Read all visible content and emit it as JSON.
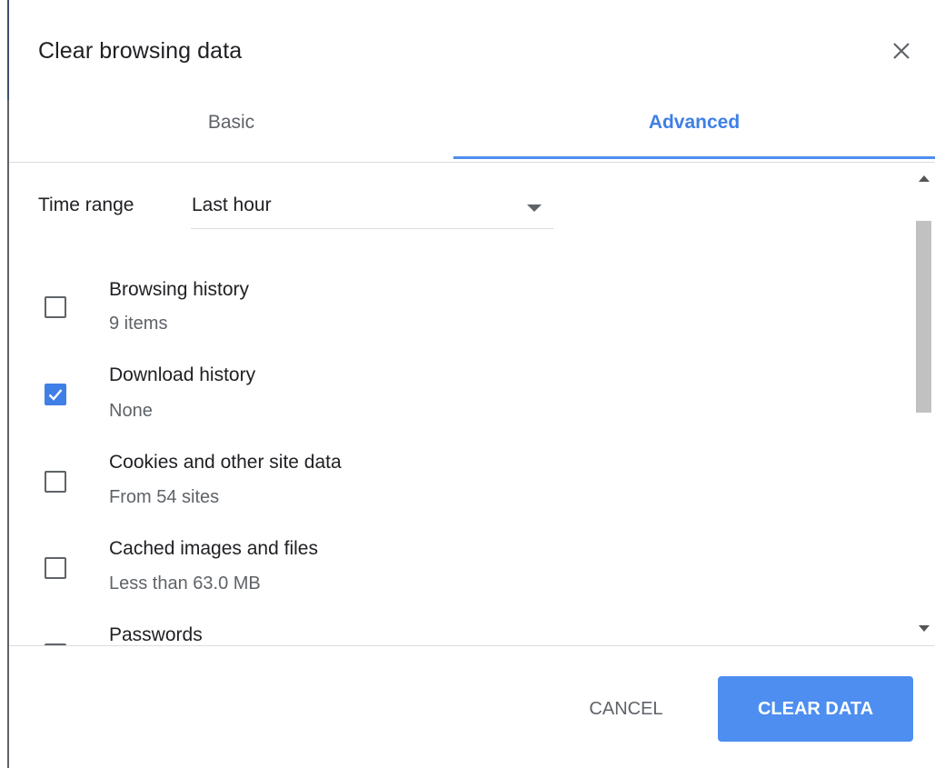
{
  "dialog": {
    "title": "Clear browsing data",
    "close_icon": "close-icon"
  },
  "tabs": [
    {
      "label": "Basic",
      "active": false
    },
    {
      "label": "Advanced",
      "active": true
    }
  ],
  "time_range": {
    "label": "Time range",
    "value": "Last hour"
  },
  "options": [
    {
      "label": "Browsing history",
      "sub": "9 items",
      "checked": false
    },
    {
      "label": "Download history",
      "sub": "None",
      "checked": true
    },
    {
      "label": "Cookies and other site data",
      "sub": "From 54 sites",
      "checked": false
    },
    {
      "label": "Cached images and files",
      "sub": "Less than 63.0 MB",
      "checked": false
    },
    {
      "label": "Passwords",
      "sub": "",
      "checked": false
    }
  ],
  "footer": {
    "cancel_label": "CANCEL",
    "clear_label": "CLEAR DATA"
  },
  "colors": {
    "accent": "#4d8ef0",
    "accent_text": "#3f7fe6"
  }
}
